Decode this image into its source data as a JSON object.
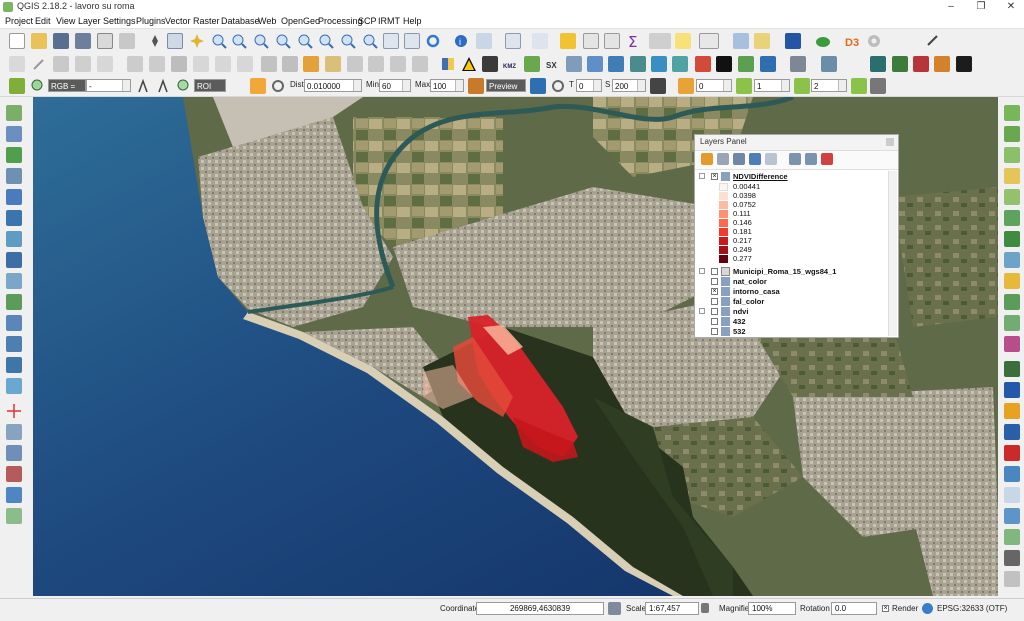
{
  "window": {
    "title": "QGIS 2.18.2 - lavoro su roma",
    "min_glyph": "–",
    "max_glyph": "❐",
    "close_glyph": "✕"
  },
  "menu": [
    "Project",
    "Edit",
    "View",
    "Layer",
    "Settings",
    "Plugins",
    "Vector",
    "Raster",
    "Database",
    "Web",
    "OpenGeo",
    "Processing",
    "SCP",
    "IRMT",
    "Help"
  ],
  "scp_toolbar": {
    "band_set": "RGB =",
    "band_value": "-",
    "roi_label": "ROI",
    "dist_label": "Dist",
    "dist_value": "0.010000",
    "min_label": "Min",
    "min_value": "60",
    "max_label": "Max",
    "max_value": "100",
    "preview_label": "Preview",
    "t_label": "T",
    "t_value": "0",
    "s_label": "S",
    "s_value": "200",
    "field1": "0",
    "field2": "1",
    "field3": "2"
  },
  "toolbar_text": {
    "kmz": "KMZ",
    "sx": "SX",
    "d3": "D3"
  },
  "layers_panel": {
    "title": "Layers Panel",
    "layers": [
      {
        "name": "NDVIDifference",
        "checked": true,
        "active": true
      },
      {
        "name": "Municipi_Roma_15_wgs84_1",
        "checked": false
      },
      {
        "name": "nat_color",
        "checked": false
      },
      {
        "name": "intorno_casa",
        "checked": true
      },
      {
        "name": "fal_color",
        "checked": false
      },
      {
        "name": "ndvi",
        "checked": false
      },
      {
        "name": "432",
        "checked": false
      },
      {
        "name": "532",
        "checked": false
      }
    ],
    "legend": [
      {
        "value": "0.00441",
        "color": "#fff5ef"
      },
      {
        "value": "0.0398",
        "color": "#fee0d2"
      },
      {
        "value": "0.0752",
        "color": "#fcbba1"
      },
      {
        "value": "0.111",
        "color": "#fc9272"
      },
      {
        "value": "0.146",
        "color": "#fb6a4a"
      },
      {
        "value": "0.181",
        "color": "#ef3b2c"
      },
      {
        "value": "0.217",
        "color": "#cb181d"
      },
      {
        "value": "0.249",
        "color": "#a50f15"
      },
      {
        "value": "0.277",
        "color": "#67000d"
      }
    ]
  },
  "status": {
    "coordinate_label": "Coordinate",
    "coordinate_value": "269869,4630839",
    "scale_label": "Scale",
    "scale_value": "1:67,457",
    "magnifier_label": "Magnifier",
    "magnifier_value": "100%",
    "rotation_label": "Rotation",
    "rotation_value": "0.0",
    "render_label": "Render",
    "crs_label": "EPSG:32633 (OTF)"
  },
  "colors": {
    "sea": "#1d3f6d",
    "land": "#5f6a49",
    "urban": "#b7b1a2",
    "forest": "#27331c",
    "ndvi_red": "#d8232a"
  }
}
